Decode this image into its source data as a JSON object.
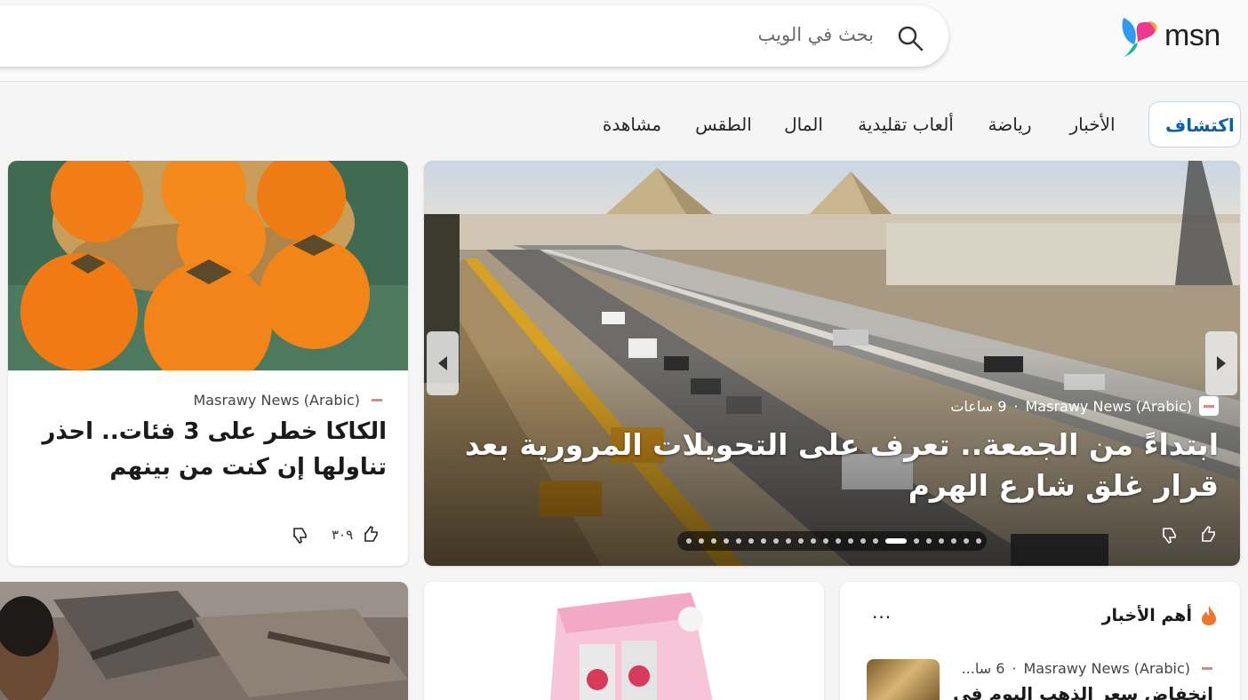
{
  "brand": {
    "logo_text": "msn"
  },
  "search": {
    "placeholder": "بحث في الويب"
  },
  "nav": {
    "items": [
      {
        "label": "اكتشاف",
        "active": true
      },
      {
        "label": "الأخبار"
      },
      {
        "label": "رياضة"
      },
      {
        "label": "ألعاب تقليدية"
      },
      {
        "label": "المال"
      },
      {
        "label": "الطقس"
      },
      {
        "label": "مشاهدة"
      }
    ]
  },
  "hero": {
    "source": "Masrawy News (Arabic)",
    "time": "9 ساعات",
    "title": "ابتداءً من الجمعة.. تعرف على التحويلات المرورية بعد قرار غلق شارع الهرم",
    "carousel_total": 23,
    "carousel_active": 16
  },
  "side_article": {
    "source": "Masrawy News (Arabic)",
    "title": "الكاكا خطر على 3 فئات.. احذر تناولها إن كنت من بينهم",
    "likes": "٣٠٩"
  },
  "top_news": {
    "heading": "أهم الأخبار",
    "more": "...",
    "item": {
      "source": "Masrawy News (Arabic)",
      "time": "6 سا...",
      "title": "انخفاض سعر الذهب اليوم في"
    }
  },
  "colors": {
    "accent": "#0f5ea8",
    "fire": "#f0742b"
  }
}
